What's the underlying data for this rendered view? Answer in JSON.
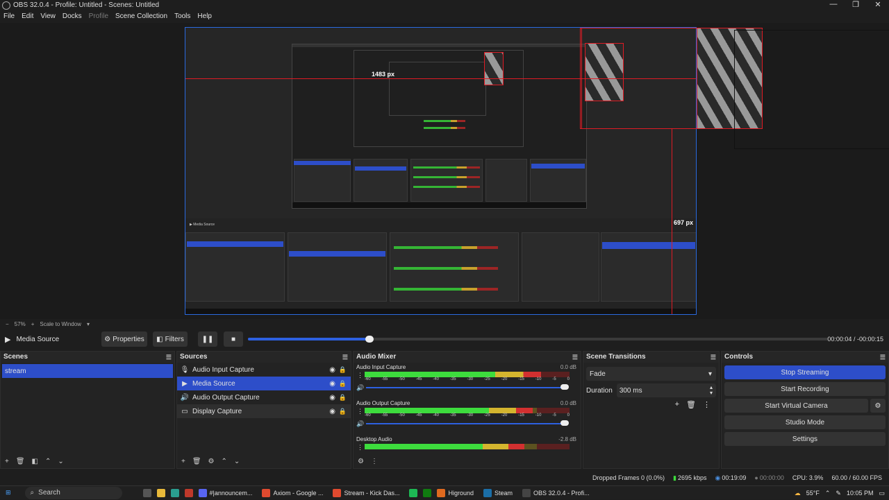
{
  "window": {
    "title": "OBS 32.0.4 - Profile: Untitled - Scenes: Untitled",
    "controls": [
      "—",
      "❐",
      "✕"
    ]
  },
  "menu": [
    "File",
    "Edit",
    "View",
    "Docks",
    "Profile",
    "Scene Collection",
    "Tools",
    "Help"
  ],
  "preview": {
    "px_label_width": "1483 px",
    "px_label_height": "697 px",
    "zoom": "57%",
    "scale_mode": "Scale to Window"
  },
  "media_controls": {
    "source_name": "Media Source",
    "properties_label": "Properties",
    "filters_label": "Filters",
    "time_current": "00:00:04",
    "time_separator": "/",
    "time_remaining": "-00:00:15",
    "progress": 0.21
  },
  "scenes": {
    "title": "Scenes",
    "items": [
      "stream"
    ]
  },
  "sources": {
    "title": "Sources",
    "items": [
      {
        "name": "Audio Input Capture",
        "icon": "microphone-icon"
      },
      {
        "name": "Media Source",
        "icon": "play-icon"
      },
      {
        "name": "Audio Output Capture",
        "icon": "speaker-icon"
      },
      {
        "name": "Display Capture",
        "icon": "monitor-icon"
      }
    ]
  },
  "mixer": {
    "title": "Audio Mixer",
    "channels": [
      {
        "name": "Audio Input Capture",
        "db": "0.0 dB",
        "level": 0.86
      },
      {
        "name": "Audio Output Capture",
        "db": "0.0 dB",
        "level": 0.82
      },
      {
        "name": "Desktop Audio",
        "db": "-2.8 dB",
        "level": 0.78
      }
    ],
    "ticks": [
      "-60",
      "-55",
      "-50",
      "-45",
      "-40",
      "-35",
      "-30",
      "-25",
      "-20",
      "-15",
      "-10",
      "-5",
      "0"
    ]
  },
  "transitions": {
    "title": "Scene Transitions",
    "selected": "Fade",
    "duration_label": "Duration",
    "duration_value": "300 ms"
  },
  "controls": {
    "title": "Controls",
    "stop_streaming": "Stop Streaming",
    "start_recording": "Start Recording",
    "start_virtual_camera": "Start Virtual Camera",
    "studio_mode": "Studio Mode",
    "settings": "Settings"
  },
  "status": {
    "dropped_frames": "Dropped Frames 0 (0.0%)",
    "bitrate": "2695 kbps",
    "stream_time": "00:19:09",
    "record_time": "00:00:00",
    "cpu": "CPU: 3.9%",
    "fps": "60.00 / 60.00 FPS"
  },
  "taskbar": {
    "search_placeholder": "Search",
    "items": [
      {
        "label": "#|announcem...",
        "color": "#5865f2"
      },
      {
        "label": "Axiom - Google ...",
        "color": "#e04a2f"
      },
      {
        "label": "Stream - Kick Das...",
        "color": "#e04a2f"
      },
      {
        "label": "Higround",
        "color": "#e06a1f"
      },
      {
        "label": "Steam",
        "color": "#1b6fa8"
      },
      {
        "label": "OBS 32.0.4 - Profi...",
        "color": "#444444"
      }
    ],
    "weather": "55°F",
    "clock": "10:05 PM"
  }
}
